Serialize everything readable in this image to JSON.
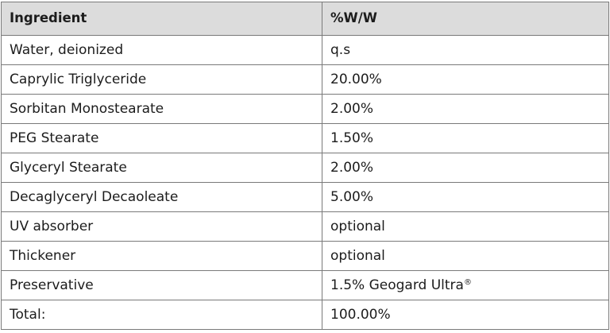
{
  "columns": [
    "Ingredient",
    "%W/W"
  ],
  "rows": [
    [
      "Water, deionized",
      "q.s"
    ],
    [
      "Caprylic Triglyceride",
      "20.00%"
    ],
    [
      "Sorbitan Monostearate",
      "2.00%"
    ],
    [
      "PEG Stearate",
      "1.50%"
    ],
    [
      "Glyceryl Stearate",
      "2.00%"
    ],
    [
      "Decaglyceryl Decaoleate",
      "5.00%"
    ],
    [
      "UV absorber",
      "optional"
    ],
    [
      "Thickener",
      "optional"
    ],
    [
      "Preservative",
      "1.5% Geogard Ultra®"
    ],
    [
      "Total:",
      "100.00%"
    ]
  ]
}
